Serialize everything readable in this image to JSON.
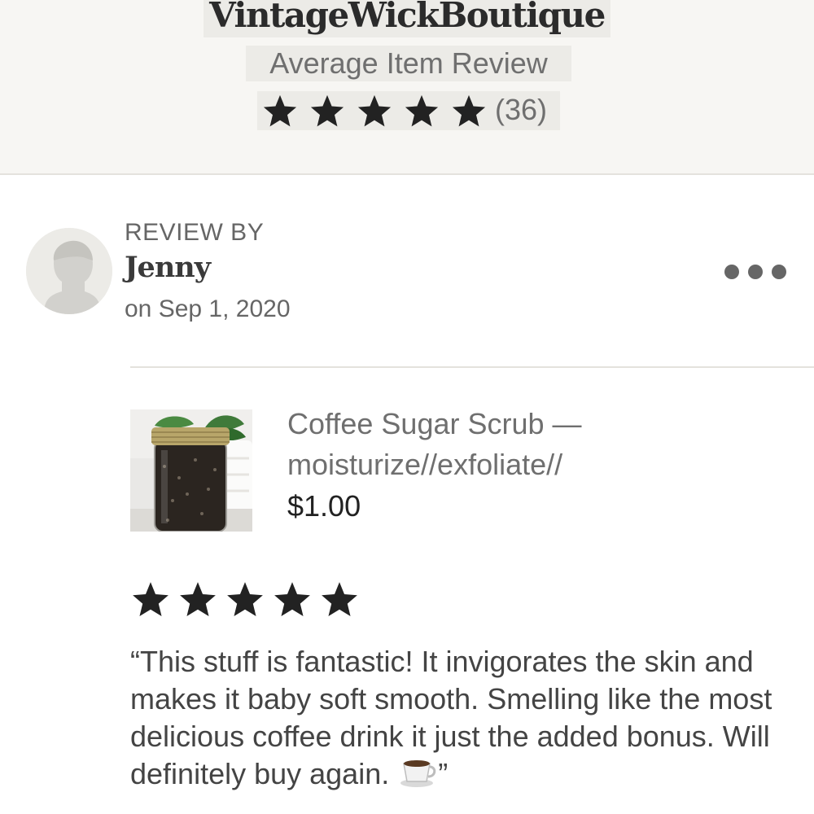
{
  "shop": {
    "name": "VintageWickBoutique",
    "average_label": "Average Item Review",
    "rating": 5,
    "review_count": "(36)"
  },
  "review": {
    "by_label": "REVIEW BY",
    "reviewer": "Jenny",
    "date": "on Sep 1, 2020",
    "rating": 5,
    "text": "“This stuff is fantastic! It invigorates the skin and makes it baby soft smooth. Smelling like the most delicious coffee drink it just the added bonus. Will definitely buy again.",
    "text_end": "”"
  },
  "product": {
    "title": "Coffee Sugar Scrub — moisturize//exfoliate//",
    "price": "$1.00"
  },
  "icons": {
    "star": "star-icon",
    "more": "more-options-icon",
    "avatar": "default-avatar-icon",
    "coffee": "coffee-cup-emoji"
  },
  "colors": {
    "header_bg": "#f7f6f3",
    "star": "#222222",
    "muted_text": "#6f6f6f"
  }
}
